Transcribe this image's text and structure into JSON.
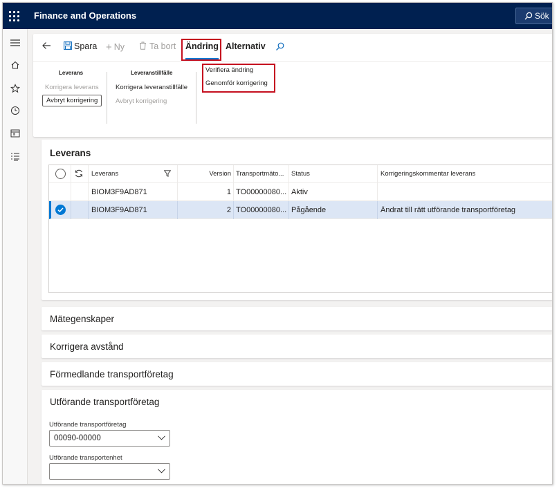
{
  "app": {
    "title": "Finance and Operations",
    "search_label": "Sök"
  },
  "toolbar": {
    "save_label": "Spara",
    "new_label": "Ny",
    "delete_label": "Ta bort",
    "tab_change": "Ändring",
    "tab_options": "Alternativ"
  },
  "ribbon": {
    "group_delivery": {
      "title": "Leverans",
      "correct_delivery": "Korrigera leverans",
      "cancel_correction": "Avbryt korrigering"
    },
    "group_occasion": {
      "title": "Leveranstillfälle",
      "correct_occasion": "Korrigera leveranstillfälle",
      "cancel_correction": "Avbryt korrigering"
    },
    "group_change": {
      "verify_change": "Verifiera ändring",
      "execute_correction": "Genomför korrigering"
    }
  },
  "delivery_section": {
    "title": "Leverans",
    "columns": [
      "Leverans",
      "Version",
      "Transportmäto...",
      "Status",
      "Korrigeringskommentar leverans"
    ],
    "rows": [
      {
        "leverans": "BIOM3F9AD871",
        "version": "1",
        "transport": "TO00000080...",
        "status": "Aktiv",
        "comment": "",
        "selected": false
      },
      {
        "leverans": "BIOM3F9AD871",
        "version": "2",
        "transport": "TO00000080...",
        "status": "Pågående",
        "comment": "Ändrat till rätt utförande transportföretag",
        "selected": true
      }
    ]
  },
  "sections": {
    "measurements": "Mätegenskaper",
    "correct_distance": "Korrigera avstånd",
    "intermediary_carrier": "Förmedlande transportföretag",
    "executing_carrier": "Utförande transportföretag"
  },
  "executing_carrier": {
    "carrier_label": "Utförande transportföretag",
    "carrier_value": "00090-00000",
    "unit_label": "Utförande transportenhet",
    "unit_value": ""
  },
  "colors": {
    "topbar": "#002050",
    "accent": "#0078d4",
    "highlight_border": "#c50f1f"
  }
}
